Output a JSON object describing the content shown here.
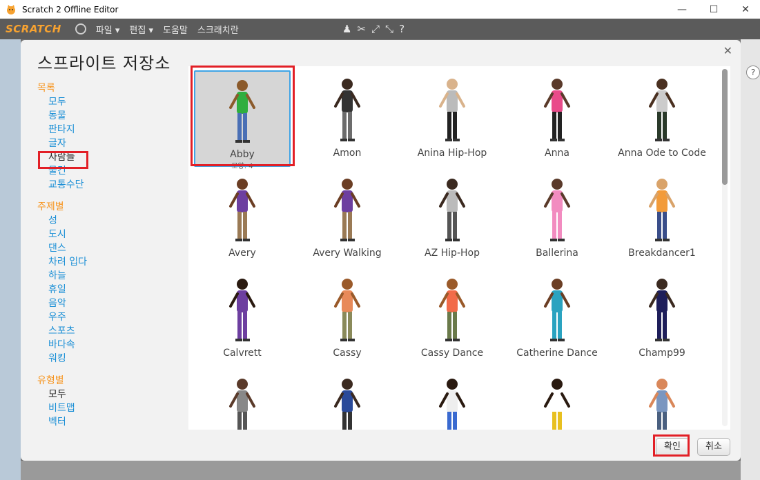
{
  "window": {
    "title": "Scratch 2 Offline Editor",
    "minimize": "—",
    "maximize": "☐",
    "close": "✕"
  },
  "menubar": {
    "logo": "SCRATCH",
    "items": [
      "파일 ▾",
      "편집 ▾",
      "도움말",
      "스크래치란"
    ]
  },
  "dialog": {
    "title": "스프라이트 저장소",
    "close": "✕",
    "ok_label": "확인",
    "cancel_label": "취소"
  },
  "sidebar": {
    "category_heading": "목록",
    "category_items": [
      "모두",
      "동물",
      "판타지",
      "글자",
      "사람들",
      "물건",
      "교통수단"
    ],
    "theme_heading": "주제별",
    "theme_items": [
      "성",
      "도시",
      "댄스",
      "차려 입다",
      "하늘",
      "휴일",
      "음악",
      "우주",
      "스포츠",
      "바다속",
      "워킹"
    ],
    "type_heading": "유형별",
    "type_items": [
      "모두",
      "비트맵",
      "벡터"
    ]
  },
  "sprites": [
    {
      "name": "Abby",
      "costumes": "모양: 4"
    },
    {
      "name": "Amon"
    },
    {
      "name": "Anina Hip-Hop"
    },
    {
      "name": "Anna"
    },
    {
      "name": "Anna Ode to Code"
    },
    {
      "name": "Avery"
    },
    {
      "name": "Avery Walking"
    },
    {
      "name": "AZ Hip-Hop"
    },
    {
      "name": "Ballerina"
    },
    {
      "name": "Breakdancer1"
    },
    {
      "name": "Calvrett"
    },
    {
      "name": "Cassy"
    },
    {
      "name": "Cassy Dance"
    },
    {
      "name": "Catherine Dance"
    },
    {
      "name": "Champ99"
    },
    {
      "name": ""
    },
    {
      "name": ""
    },
    {
      "name": ""
    },
    {
      "name": ""
    },
    {
      "name": ""
    }
  ],
  "colors": {
    "accent_red": "#e21f26",
    "category_orange": "#f7941d",
    "link_blue": "#1a8fd6",
    "selection_blue": "#3fa4e6"
  },
  "right_panel": {
    "help": "?"
  }
}
